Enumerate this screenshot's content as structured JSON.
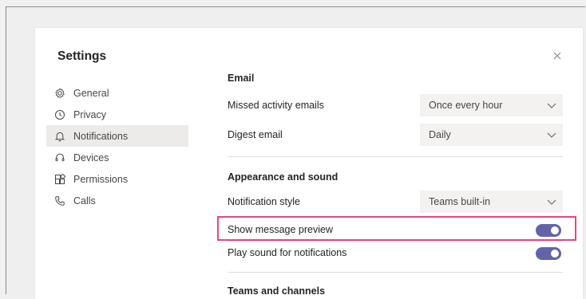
{
  "dialog": {
    "title": "Settings",
    "close_icon": "close-icon"
  },
  "nav": {
    "items": [
      {
        "label": "General",
        "icon": "gear-icon"
      },
      {
        "label": "Privacy",
        "icon": "lock-icon"
      },
      {
        "label": "Notifications",
        "icon": "bell-icon",
        "active": true
      },
      {
        "label": "Devices",
        "icon": "headset-icon"
      },
      {
        "label": "Permissions",
        "icon": "apps-icon"
      },
      {
        "label": "Calls",
        "icon": "phone-icon"
      }
    ]
  },
  "email": {
    "heading": "Email",
    "missed_label": "Missed activity emails",
    "missed_value": "Once every hour",
    "digest_label": "Digest email",
    "digest_value": "Daily"
  },
  "appearance": {
    "heading": "Appearance and sound",
    "style_label": "Notification style",
    "style_value": "Teams built-in",
    "preview_label": "Show message preview",
    "preview_on": true,
    "sound_label": "Play sound for notifications",
    "sound_on": true
  },
  "teams": {
    "heading": "Teams and channels"
  },
  "colors": {
    "accent": "#6264a7",
    "highlight": "#e8467c"
  }
}
